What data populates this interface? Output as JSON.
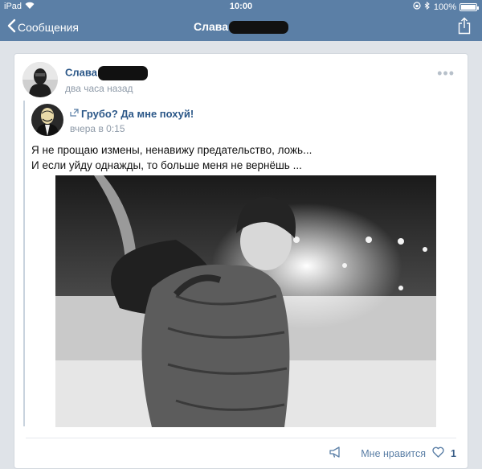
{
  "status_bar": {
    "device": "iPad",
    "time": "10:00",
    "battery": "100%"
  },
  "nav": {
    "back_label": "Сообщения",
    "title": "Слава"
  },
  "post": {
    "author": "Слава",
    "time": "два часа назад",
    "repost": {
      "source_title": "Грубо? Да мне похуй!",
      "time": "вчера в 0:15",
      "text_line1": "Я не прощаю измены, ненавижу предательство, ложь...",
      "text_line2": "И если уйду однажды, то больше меня не вернёшь ..."
    },
    "likes_label": "Мне нравится",
    "likes_count": "1"
  },
  "colors": {
    "nav_bg": "#5b7fa6",
    "link": "#2b5788",
    "muted": "#8e9aa8"
  }
}
